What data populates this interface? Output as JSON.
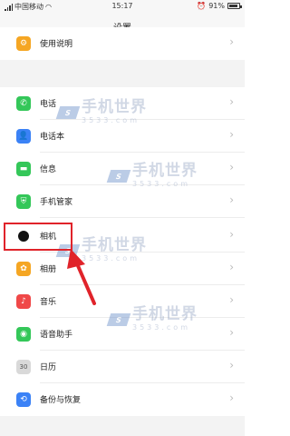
{
  "status_bar": {
    "carrier": "中国移动",
    "time": "15:17",
    "battery_percent": "91%",
    "battery_level": 0.91
  },
  "header": {
    "title": "设置"
  },
  "rows": [
    {
      "label": "使用说明",
      "icon": "help-icon",
      "color": "#f5a623"
    },
    {
      "label": "电话",
      "icon": "phone-icon",
      "color": "#34c759"
    },
    {
      "label": "电话本",
      "icon": "contacts-icon",
      "color": "#3b82f6"
    },
    {
      "label": "信息",
      "icon": "message-icon",
      "color": "#34c759"
    },
    {
      "label": "手机管家",
      "icon": "shield-icon",
      "color": "#34c759"
    },
    {
      "label": "相机",
      "icon": "camera-icon",
      "color": "#111111"
    },
    {
      "label": "相册",
      "icon": "gallery-icon",
      "color": "#f5a623"
    },
    {
      "label": "音乐",
      "icon": "music-icon",
      "color": "#f04848"
    },
    {
      "label": "语音助手",
      "icon": "voice-assistant-icon",
      "color": "#34c759"
    },
    {
      "label": "日历",
      "icon": "calendar-icon",
      "color": "#d9d9d9",
      "text": "30"
    },
    {
      "label": "备份与恢复",
      "icon": "backup-icon",
      "color": "#3b82f6"
    }
  ],
  "watermark": {
    "text": "手机世界",
    "number": "3533.com"
  }
}
